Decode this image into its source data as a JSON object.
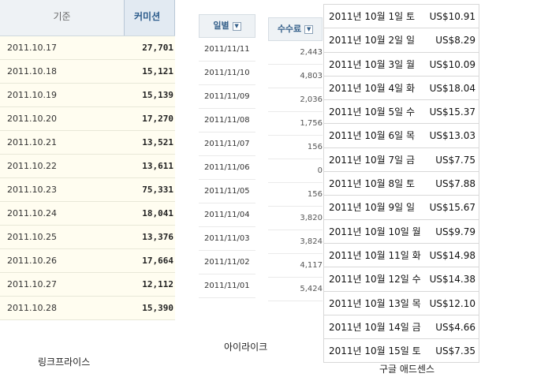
{
  "linkprice": {
    "caption": "링크프라이스",
    "header": {
      "date_col": "기준",
      "value_col": "커미션"
    },
    "rows": [
      {
        "date": "2011.10.17",
        "value": "27,701"
      },
      {
        "date": "2011.10.18",
        "value": "15,121"
      },
      {
        "date": "2011.10.19",
        "value": "15,139"
      },
      {
        "date": "2011.10.20",
        "value": "17,270"
      },
      {
        "date": "2011.10.21",
        "value": "13,521"
      },
      {
        "date": "2011.10.22",
        "value": "13,611"
      },
      {
        "date": "2011.10.23",
        "value": "75,331"
      },
      {
        "date": "2011.10.24",
        "value": "18,041"
      },
      {
        "date": "2011.10.25",
        "value": "13,376"
      },
      {
        "date": "2011.10.26",
        "value": "17,664"
      },
      {
        "date": "2011.10.27",
        "value": "12,112"
      },
      {
        "date": "2011.10.28",
        "value": "15,390"
      }
    ]
  },
  "ilike": {
    "caption": "아이라이크",
    "header": {
      "date_col": "일별",
      "amount_col": "수수료"
    },
    "dates": [
      "2011/11/11",
      "2011/11/10",
      "2011/11/09",
      "2011/11/08",
      "2011/11/07",
      "2011/11/06",
      "2011/11/05",
      "2011/11/04",
      "2011/11/03",
      "2011/11/02",
      "2011/11/01"
    ],
    "amounts": [
      "2,443",
      "4,803",
      "2,036",
      "1,756",
      "156",
      "0",
      "156",
      "3,820",
      "3,824",
      "4,117",
      "5,424"
    ]
  },
  "adsense": {
    "caption": "구글 애드센스",
    "rows": [
      {
        "date": "2011년 10월 1일 토",
        "value": "US$10.91"
      },
      {
        "date": "2011년 10월 2일 일",
        "value": "US$8.29"
      },
      {
        "date": "2011년 10월 3일 월",
        "value": "US$10.09"
      },
      {
        "date": "2011년 10월 4일 화",
        "value": "US$18.04"
      },
      {
        "date": "2011년 10월 5일 수",
        "value": "US$15.37"
      },
      {
        "date": "2011년 10월 6일 목",
        "value": "US$13.03"
      },
      {
        "date": "2011년 10월 7일 금",
        "value": "US$7.75"
      },
      {
        "date": "2011년 10월 8일 토",
        "value": "US$7.88"
      },
      {
        "date": "2011년 10월 9일 일",
        "value": "US$15.67"
      },
      {
        "date": "2011년 10월 10일 월",
        "value": "US$9.79"
      },
      {
        "date": "2011년 10월 11일 화",
        "value": "US$14.98"
      },
      {
        "date": "2011년 10월 12일 수",
        "value": "US$14.38"
      },
      {
        "date": "2011년 10월 13일 목",
        "value": "US$12.10"
      },
      {
        "date": "2011년 10월 14일 금",
        "value": "US$4.66"
      },
      {
        "date": "2011년 10월 15일 토",
        "value": "US$7.35"
      }
    ]
  }
}
